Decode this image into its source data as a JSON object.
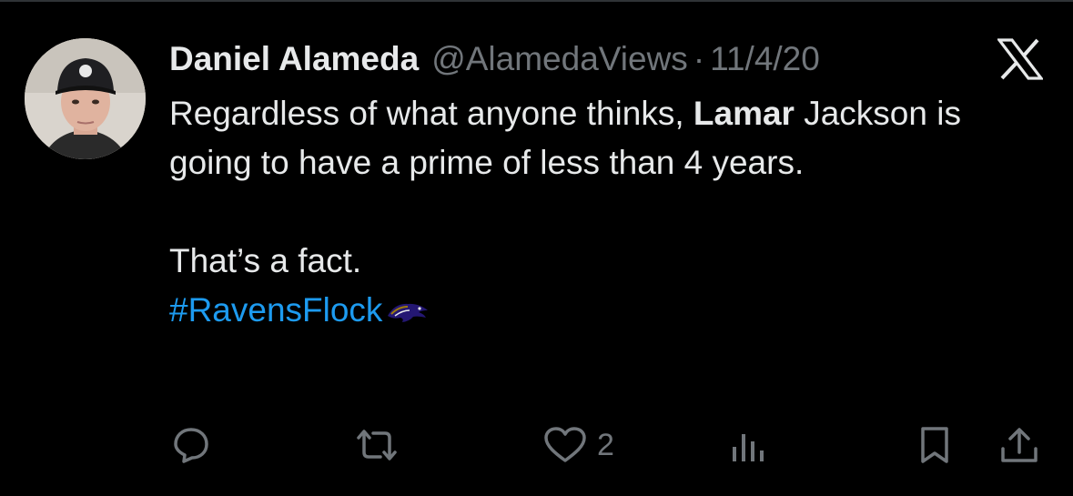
{
  "tweet": {
    "author_name": "Daniel Alameda",
    "handle": "@AlamedaViews",
    "separator": "·",
    "date": "11/4/20",
    "body": {
      "line1_prefix": "Regardless of what anyone thinks, ",
      "line1_bold": "Lamar",
      "line2": "Jackson is going to have a prime of less than 4 years.",
      "line3": "That’s a fact.",
      "hashtag": "#RavensFlock"
    }
  },
  "actions": {
    "reply_count": "",
    "retweet_count": "",
    "like_count": "2",
    "views_count": ""
  },
  "colors": {
    "background": "#000000",
    "text": "#e7e9ea",
    "muted": "#71767b",
    "link": "#1d9bf0"
  },
  "icons": [
    "x-logo-icon",
    "ravens-hashflag-icon",
    "reply-icon",
    "retweet-icon",
    "heart-icon",
    "views-icon",
    "bookmark-icon",
    "share-icon"
  ]
}
